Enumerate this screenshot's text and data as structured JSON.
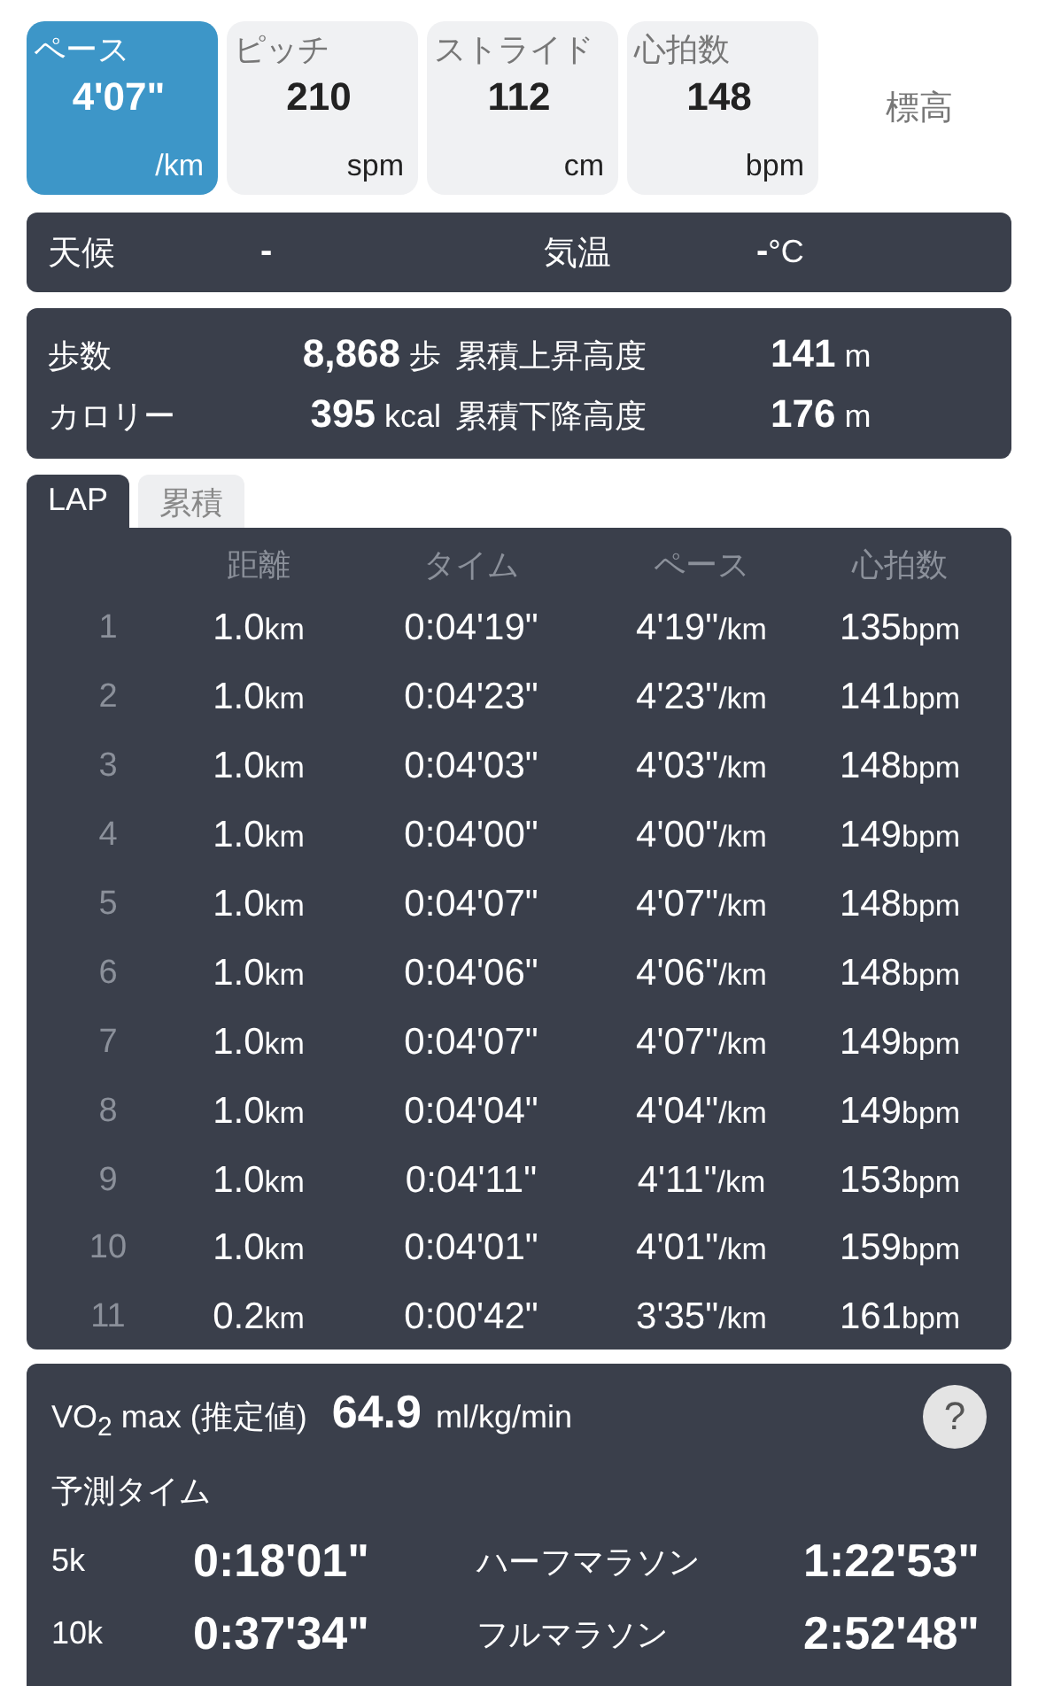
{
  "metrics": [
    {
      "label": "ペース",
      "value": "4'07\"",
      "unit": "/km",
      "selected": true
    },
    {
      "label": "ピッチ",
      "value": "210",
      "unit": "spm",
      "selected": false
    },
    {
      "label": "ストライド",
      "value": "112",
      "unit": "cm",
      "selected": false
    },
    {
      "label": "心拍数",
      "value": "148",
      "unit": "bpm",
      "selected": false
    }
  ],
  "elevation_tab": {
    "label": "標高",
    "selected": false
  },
  "weather": [
    {
      "label": "天候",
      "value": "-"
    },
    {
      "label": "気温",
      "value": "-",
      "unit": "°C"
    }
  ],
  "summary": [
    {
      "label": "歩数",
      "value": "8,868",
      "unit": "歩"
    },
    {
      "label": "累積上昇高度",
      "value": "141",
      "unit": "m"
    },
    {
      "label": "カロリー",
      "value": "395",
      "unit": "kcal"
    },
    {
      "label": "累積下降高度",
      "value": "176",
      "unit": "m"
    }
  ],
  "tabs": [
    {
      "label": "LAP",
      "selected": true
    },
    {
      "label": "累積",
      "selected": false
    }
  ],
  "lap_table": {
    "columns": [
      "距離",
      "タイム",
      "ペース",
      "心拍数"
    ],
    "rows": [
      {
        "index": "1",
        "cells": [
          {
            "value": "1.0",
            "unit": "km"
          },
          {
            "value": "0:04'19\""
          },
          {
            "value": "4'19\"",
            "unit": "/km"
          },
          {
            "value": "135",
            "unit": "bpm"
          }
        ]
      },
      {
        "index": "2",
        "cells": [
          {
            "value": "1.0",
            "unit": "km"
          },
          {
            "value": "0:04'23\""
          },
          {
            "value": "4'23\"",
            "unit": "/km"
          },
          {
            "value": "141",
            "unit": "bpm"
          }
        ]
      },
      {
        "index": "3",
        "cells": [
          {
            "value": "1.0",
            "unit": "km"
          },
          {
            "value": "0:04'03\""
          },
          {
            "value": "4'03\"",
            "unit": "/km"
          },
          {
            "value": "148",
            "unit": "bpm"
          }
        ]
      },
      {
        "index": "4",
        "cells": [
          {
            "value": "1.0",
            "unit": "km"
          },
          {
            "value": "0:04'00\""
          },
          {
            "value": "4'00\"",
            "unit": "/km"
          },
          {
            "value": "149",
            "unit": "bpm"
          }
        ]
      },
      {
        "index": "5",
        "cells": [
          {
            "value": "1.0",
            "unit": "km"
          },
          {
            "value": "0:04'07\""
          },
          {
            "value": "4'07\"",
            "unit": "/km"
          },
          {
            "value": "148",
            "unit": "bpm"
          }
        ]
      },
      {
        "index": "6",
        "cells": [
          {
            "value": "1.0",
            "unit": "km"
          },
          {
            "value": "0:04'06\""
          },
          {
            "value": "4'06\"",
            "unit": "/km"
          },
          {
            "value": "148",
            "unit": "bpm"
          }
        ]
      },
      {
        "index": "7",
        "cells": [
          {
            "value": "1.0",
            "unit": "km"
          },
          {
            "value": "0:04'07\""
          },
          {
            "value": "4'07\"",
            "unit": "/km"
          },
          {
            "value": "149",
            "unit": "bpm"
          }
        ]
      },
      {
        "index": "8",
        "cells": [
          {
            "value": "1.0",
            "unit": "km"
          },
          {
            "value": "0:04'04\""
          },
          {
            "value": "4'04\"",
            "unit": "/km"
          },
          {
            "value": "149",
            "unit": "bpm"
          }
        ]
      },
      {
        "index": "9",
        "cells": [
          {
            "value": "1.0",
            "unit": "km"
          },
          {
            "value": "0:04'11\""
          },
          {
            "value": "4'11\"",
            "unit": "/km"
          },
          {
            "value": "153",
            "unit": "bpm"
          }
        ]
      },
      {
        "index": "10",
        "cells": [
          {
            "value": "1.0",
            "unit": "km"
          },
          {
            "value": "0:04'01\""
          },
          {
            "value": "4'01\"",
            "unit": "/km"
          },
          {
            "value": "159",
            "unit": "bpm"
          }
        ]
      },
      {
        "index": "11",
        "cells": [
          {
            "value": "0.2",
            "unit": "km"
          },
          {
            "value": "0:00'42\""
          },
          {
            "value": "3'35\"",
            "unit": "/km"
          },
          {
            "value": "161",
            "unit": "bpm"
          }
        ]
      }
    ]
  },
  "vo2": {
    "label": "VO$_{2}$ max (推定値)",
    "value": "64.9",
    "unit": "ml/kg/min",
    "help": "?"
  },
  "prediction": {
    "title": "予測タイム",
    "items": [
      {
        "label": "5k",
        "value": "0:18'01\""
      },
      {
        "label": "ハーフマラソン",
        "value": "1:22'53\""
      },
      {
        "label": "10k",
        "value": "0:37'34\""
      },
      {
        "label": "フルマラソン",
        "value": "2:52'48\""
      }
    ]
  }
}
